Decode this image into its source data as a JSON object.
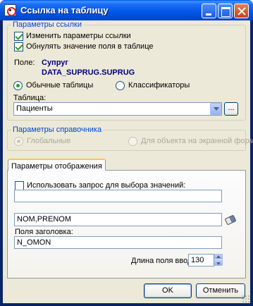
{
  "window": {
    "title": "Ссылка на таблицу"
  },
  "ref_params": {
    "legend": "Параметры ссылки",
    "change_params_label": "Изменить параметры ссылки",
    "change_params_checked": true,
    "reset_field_label": "Обнулять значение поля в таблице",
    "reset_field_checked": true,
    "field_label": "Поле:",
    "field_name_1": "Супруг",
    "field_name_2": "DATA_SUPRUG.SUPRUG",
    "radio_normal_label": "Обычные таблицы",
    "radio_classifiers_label": "Классификаторы",
    "selected_source": "Обычные таблицы",
    "table_label": "Таблица:",
    "table_value": "Пациенты",
    "browse_label": "..."
  },
  "directory_params": {
    "legend": "Параметры справочника",
    "radio_global_label": "Глобальные",
    "radio_object_label": "Для объекта на экранной форме"
  },
  "display_params": {
    "tab_label": "Параметры отображения",
    "use_query_label": "Использовать запрос для выбора значений:",
    "use_query_checked": false,
    "query_value": "",
    "fields_value": "NOM,PRENOM",
    "header_fields_label": "Поля заголовка:",
    "header_fields_value": "N_OMON",
    "input_length_label": "Длина поля ввода:",
    "input_length_value": "130"
  },
  "footer": {
    "ok_label": "OK",
    "cancel_label": "Отменить"
  },
  "colors": {
    "titlebar": "#0055e6",
    "dialog_bg": "#ece9d8",
    "group_legend": "#0046d5",
    "field_text": "#00007c"
  }
}
